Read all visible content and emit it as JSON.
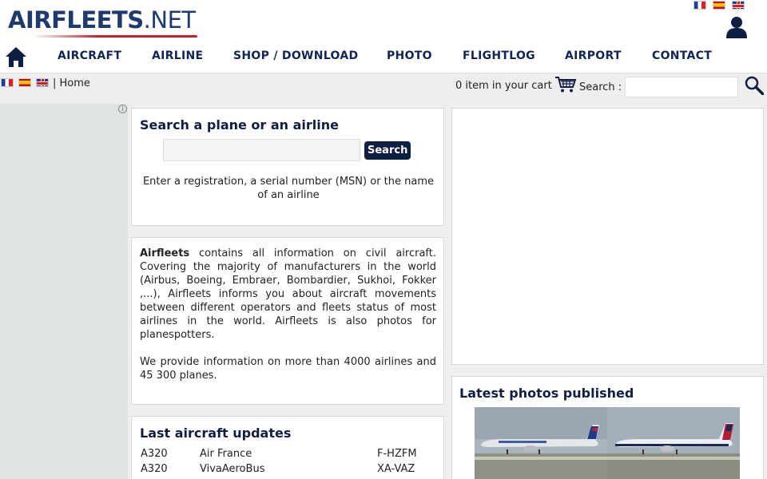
{
  "header": {
    "logo_main": "AIRFLEETS",
    "logo_suffix": ".NET",
    "nav": [
      {
        "label": "AIRCRAFT"
      },
      {
        "label": "AIRLINE"
      },
      {
        "label": "SHOP / DOWNLOAD"
      },
      {
        "label": "PHOTO"
      },
      {
        "label": "FLIGHTLOG"
      },
      {
        "label": "AIRPORT"
      },
      {
        "label": "CONTACT"
      }
    ],
    "languages": [
      "fr-flag",
      "es-flag",
      "gb-flag"
    ],
    "icons": {
      "home": "home-icon",
      "user": "user-icon",
      "cart": "cart-icon",
      "search": "magnifier-icon"
    }
  },
  "subbar": {
    "breadcrumb": "| Home",
    "cart_text": "0 item in your cart",
    "search_label": "Search :",
    "search_value": ""
  },
  "search_box": {
    "title": "Search a plane or an airline",
    "input_value": "",
    "button_label": "Search",
    "help": "Enter a registration, a serial number (MSN) or the name of an airline"
  },
  "about": {
    "brand": "Airfleets",
    "paragraph1": " contains all information on civil aircraft. Covering the majority of manufacturers in the world (Airbus, Boeing, Embraer, Bombardier, Sukhoi, Fokker ,...), Airfleets informs you about aircraft movements between different operators and fleets status of most airlines in the world. Airfleets is also photos for planespotters.",
    "paragraph2": "We provide information on more than 4000 airlines and 45 300 planes."
  },
  "updates": {
    "title": "Last aircraft updates",
    "rows": [
      {
        "type": "A320",
        "airline": "Air France",
        "reg": "F-HZFM"
      },
      {
        "type": "A320",
        "airline": "VivaAeroBus",
        "reg": "XA-VAZ"
      }
    ]
  },
  "photos": {
    "title": "Latest photos published"
  },
  "colors": {
    "navy": "#0f1f44",
    "logo_blue": "#1f3b6e",
    "logo_red": "#c8202a",
    "sidebar": "#dfe3e3"
  }
}
